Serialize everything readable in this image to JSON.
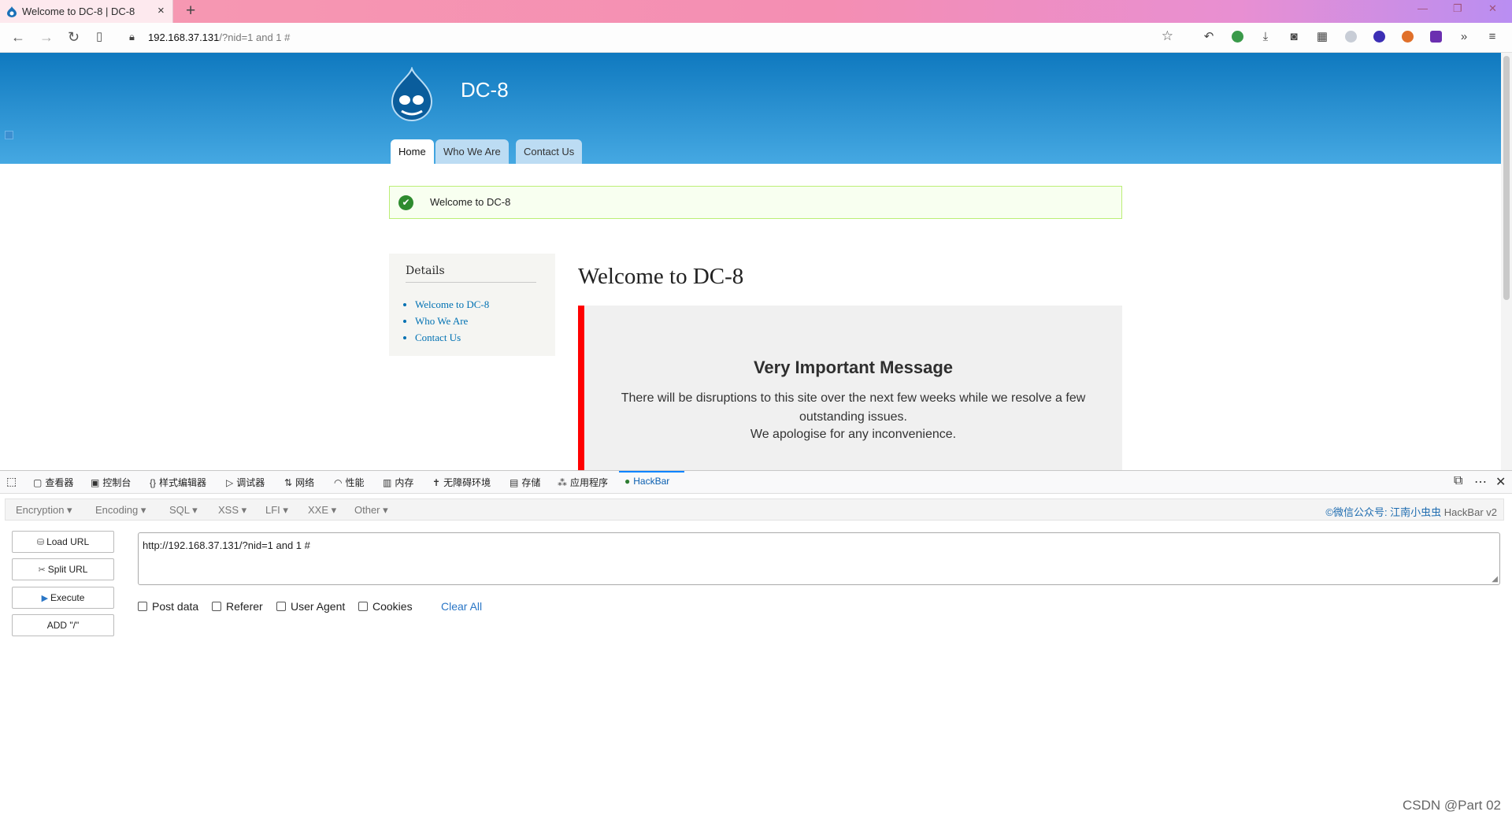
{
  "browser": {
    "tab_title": "Welcome to DC-8 | DC-8",
    "tab_close": "×",
    "new_tab": "+",
    "url_host": "192.168.37.131",
    "url_path": "/?nid=1 and 1 #"
  },
  "site": {
    "name": "DC-8",
    "tabs": [
      "Home",
      "Who We Are",
      "Contact Us"
    ],
    "active_tab": "Home",
    "status_message": "Welcome to DC-8",
    "sidebar": {
      "heading": "Details",
      "links": [
        "Welcome to DC-8",
        "Who We Are",
        "Contact Us"
      ]
    },
    "page_title": "Welcome to DC-8",
    "notice": {
      "heading": "Very Important Message",
      "paragraph1": "There will be disruptions to this site over the next few weeks while we resolve a few outstanding issues.",
      "paragraph2": "We apologise for any inconvenience."
    },
    "colors": {
      "header_top": "#0f79bf",
      "header_bottom": "#45a8e2",
      "notice_border": "#ff0000",
      "link": "#0071b3"
    }
  },
  "devtools": {
    "tabs": [
      "查看器",
      "控制台",
      "样式编辑器",
      "调试器",
      "网络",
      "性能",
      "内存",
      "无障碍环境",
      "存储",
      "应用程序",
      "HackBar"
    ],
    "active_tab": "HackBar"
  },
  "hackbar": {
    "menus": [
      "Encryption",
      "Encoding",
      "SQL",
      "XSS",
      "LFI",
      "XXE",
      "Other"
    ],
    "credit": "©微信公众号: 江南小虫虫",
    "version": "HackBar v2",
    "buttons": {
      "load": "Load URL",
      "split": "Split URL",
      "execute": "Execute",
      "add": "ADD \"/\""
    },
    "url_value": "http://192.168.37.131/?nid=1 and 1 #",
    "options": [
      "Post data",
      "Referer",
      "User Agent",
      "Cookies"
    ],
    "clear_all": "Clear All"
  },
  "watermark": "CSDN @Part 02"
}
